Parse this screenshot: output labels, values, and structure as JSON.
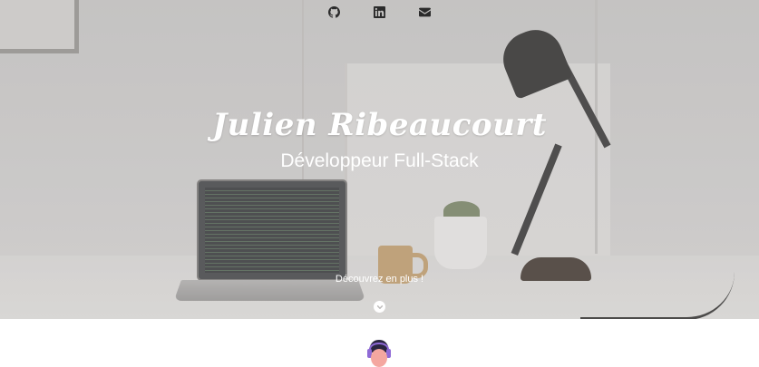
{
  "header": {
    "social_links": [
      {
        "icon": "github-icon",
        "label": "GitHub"
      },
      {
        "icon": "linkedin-icon",
        "label": "LinkedIn"
      },
      {
        "icon": "envelope-icon",
        "label": "Email"
      }
    ]
  },
  "hero": {
    "name": "Julien Ribeaucourt",
    "role": "Développeur Full-Stack",
    "discover_label": "Découvrez en plus !",
    "scroll_icon": "chevron-down-icon"
  },
  "colors": {
    "hero_text": "#ffffff",
    "icon": "#2b2b2b",
    "avatar_hair": "#2a2540",
    "avatar_headphones": "#8f6ad6",
    "avatar_skin": "#f4a7a0"
  }
}
